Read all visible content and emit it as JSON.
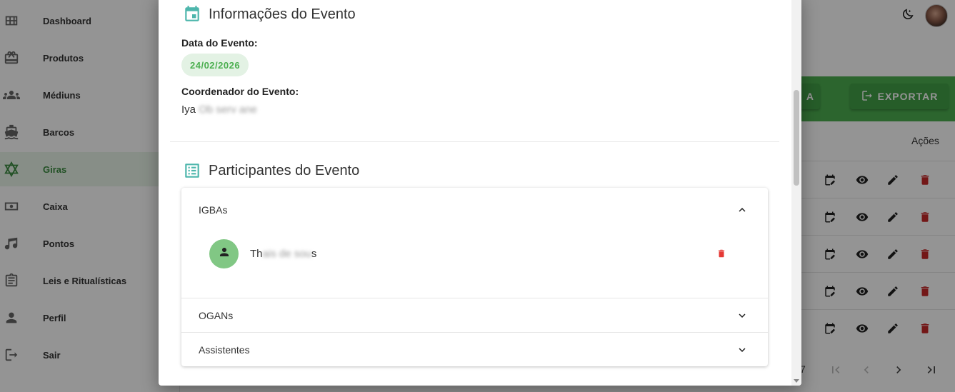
{
  "sidebar": {
    "items": [
      {
        "label": "Dashboard",
        "icon": "grid-icon",
        "active": false
      },
      {
        "label": "Produtos",
        "icon": "gift-icon",
        "active": false
      },
      {
        "label": "Médiuns",
        "icon": "group-icon",
        "active": false
      },
      {
        "label": "Barcos",
        "icon": "boat-icon",
        "active": false
      },
      {
        "label": "Giras",
        "icon": "star-of-david-icon",
        "active": true
      },
      {
        "label": "Caixa",
        "icon": "cash-icon",
        "active": false
      },
      {
        "label": "Pontos",
        "icon": "music-note-icon",
        "active": false
      },
      {
        "label": "Leis e Ritualísticas",
        "icon": "clipboard-icon",
        "active": false
      },
      {
        "label": "Perfil",
        "icon": "person-icon",
        "active": false
      },
      {
        "label": "Sair",
        "icon": "logout-icon",
        "active": false
      }
    ]
  },
  "toolbar": {
    "partial_button_label": "A",
    "export_label": "EXPORTAR"
  },
  "table": {
    "actions_header": "Ações",
    "row_count": 5
  },
  "pagination": {
    "partial_text": "7"
  },
  "modal": {
    "event_info_title": "Informações do Evento",
    "date_label": "Data do Evento:",
    "date_value": "24/02/2026",
    "coordinator_label": "Coordenador do Evento:",
    "coordinator_visible": "Iya",
    "coordinator_obscured": "Ob serv ane",
    "participants_title": "Participantes do Evento",
    "groups": [
      {
        "label": "IGBAs",
        "expanded": true,
        "members": [
          {
            "name_visible": "Th",
            "name_obscured": "ais de sou",
            "name_tail": "s"
          }
        ]
      },
      {
        "label": "OGANs",
        "expanded": false
      },
      {
        "label": "Assistentes",
        "expanded": false
      }
    ]
  },
  "colors": {
    "primary_green": "#4caf50",
    "active_green": "#3c8c40",
    "teal_icon": "#4db6ac",
    "delete_red": "#c62828",
    "delete_light_red": "#e53935"
  }
}
